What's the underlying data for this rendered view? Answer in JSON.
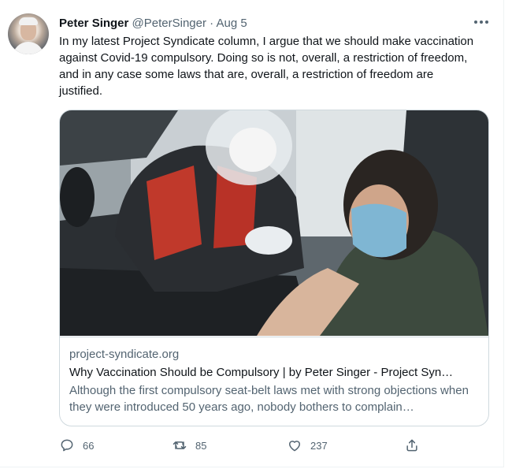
{
  "tweet": {
    "author_name": "Peter Singer",
    "author_handle": "@PeterSinger",
    "separator": "·",
    "date": "Aug 5",
    "text": "In my latest Project Syndicate column, I argue that we should make vaccination against Covid-19 compulsory. Doing so is not, overall, a restriction of freedom, and in any case some laws that are, overall, a restriction of freedom are justified."
  },
  "card": {
    "domain": "project-syndicate.org",
    "title": "Why Vaccination Should be Compulsory | by Peter Singer - Project Syn…",
    "description": "Although the first compulsory seat-belt laws met with strong objections when they were introduced 50 years ago, nobody bothers to complain…"
  },
  "actions": {
    "replies": "66",
    "retweets": "85",
    "likes": "237"
  },
  "icons": {
    "more": "more-horizontal-icon",
    "reply": "reply-icon",
    "retweet": "retweet-icon",
    "like": "heart-icon",
    "share": "share-icon"
  },
  "colors": {
    "text": "#0f1419",
    "secondary": "#536471",
    "border": "#cfd9de"
  }
}
